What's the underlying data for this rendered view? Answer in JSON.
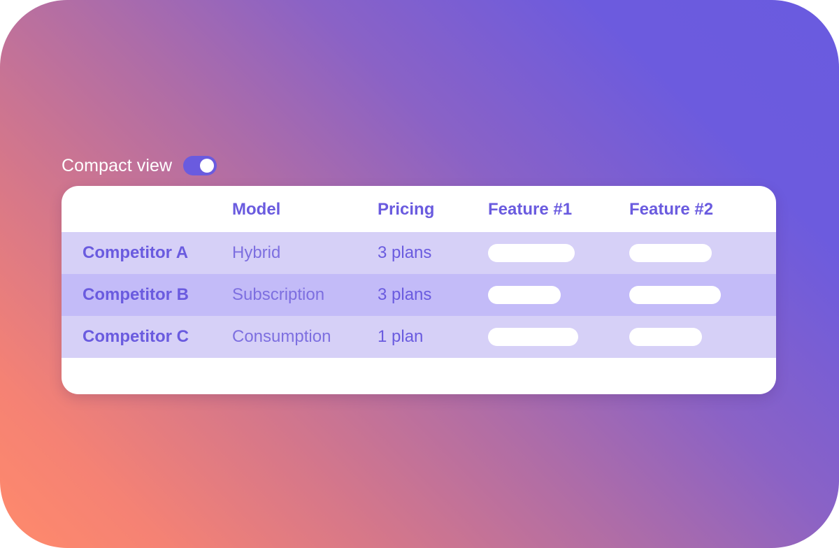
{
  "colors": {
    "accent": "#6a5bdf",
    "gradient_start": "#ff8a6b",
    "gradient_end": "#6a5bdf",
    "row_light": "#d6d0f7",
    "row_dark": "#c3bbf8"
  },
  "toggle": {
    "label": "Compact view",
    "state": "on",
    "icon": "toggle-switch-icon"
  },
  "table": {
    "headers": [
      "",
      "Model",
      "Pricing",
      "Feature #1",
      "Feature #2"
    ],
    "rows": [
      {
        "name": "Competitor A",
        "model": "Hybrid",
        "pricing": "3 plans",
        "feature1_placeholder_fill": 0.74,
        "feature2_placeholder_fill": 0.7
      },
      {
        "name": "Competitor B",
        "model": "Subscription",
        "pricing": "3 plans",
        "feature1_placeholder_fill": 0.62,
        "feature2_placeholder_fill": 0.78
      },
      {
        "name": "Competitor C",
        "model": "Consumption",
        "pricing": "1 plan",
        "feature1_placeholder_fill": 0.77,
        "feature2_placeholder_fill": 0.62
      }
    ]
  }
}
